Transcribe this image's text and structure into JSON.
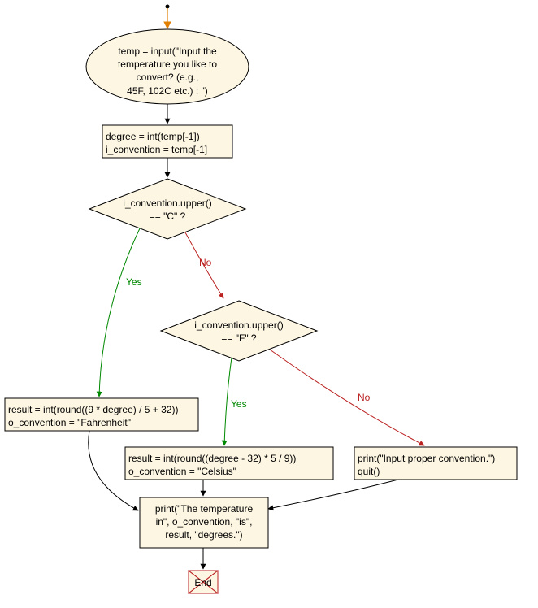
{
  "chart_data": {
    "type": "flowchart",
    "nodes": [
      {
        "id": "start",
        "shape": "point",
        "label": ""
      },
      {
        "id": "input",
        "shape": "ellipse",
        "label": "temp = input(\"Input the\ntemperature you like to\nconvert? (e.g.,\n45F, 102C etc.) : \")"
      },
      {
        "id": "parse",
        "shape": "rect",
        "label": "degree = int(temp[-1])\ni_convention = temp[-1]"
      },
      {
        "id": "decC",
        "shape": "diamond",
        "label": "i_convention.upper()\n== \"C\" ?"
      },
      {
        "id": "decF",
        "shape": "diamond",
        "label": "i_convention.upper()\n== \"F\" ?"
      },
      {
        "id": "convC",
        "shape": "rect",
        "label": "result = int(round((9 * degree) / 5 + 32))\no_convention = \"Fahrenheit\""
      },
      {
        "id": "convF",
        "shape": "rect",
        "label": "result = int(round((degree - 32) * 5 / 9))\no_convention = \"Celsius\""
      },
      {
        "id": "err",
        "shape": "rect",
        "label": "print(\"Input proper convention.\")\nquit()"
      },
      {
        "id": "print",
        "shape": "rect",
        "label": "print(\"The temperature\nin\", o_convention, \"is\",\nresult, \"degrees.\")"
      },
      {
        "id": "end",
        "shape": "end",
        "label": "End"
      }
    ],
    "edges": [
      {
        "from": "start",
        "to": "input",
        "label": ""
      },
      {
        "from": "input",
        "to": "parse",
        "label": ""
      },
      {
        "from": "parse",
        "to": "decC",
        "label": ""
      },
      {
        "from": "decC",
        "to": "convC",
        "label": "Yes"
      },
      {
        "from": "decC",
        "to": "decF",
        "label": "No"
      },
      {
        "from": "decF",
        "to": "convF",
        "label": "Yes"
      },
      {
        "from": "decF",
        "to": "err",
        "label": "No"
      },
      {
        "from": "convC",
        "to": "print",
        "label": ""
      },
      {
        "from": "convF",
        "to": "print",
        "label": ""
      },
      {
        "from": "err",
        "to": "print",
        "label": ""
      },
      {
        "from": "print",
        "to": "end",
        "label": ""
      }
    ]
  },
  "labels": {
    "input": "temp = input(\"Input the\ntemperature you like to\nconvert? (e.g.,\n45F, 102C etc.) : \")",
    "parse": "degree = int(temp[-1])\ni_convention = temp[-1]",
    "decC": "i_convention.upper()\n== \"C\" ?",
    "decF": "i_convention.upper()\n== \"F\" ?",
    "convC": "result = int(round((9 * degree) / 5 + 32))\no_convention = \"Fahrenheit\"",
    "convF": "result = int(round((degree - 32) * 5 / 9))\no_convention = \"Celsius\"",
    "err": "print(\"Input proper convention.\")\nquit()",
    "print": "print(\"The temperature\nin\", o_convention, \"is\",\nresult, \"degrees.\")",
    "end": "End",
    "yes": "Yes",
    "no": "No"
  }
}
